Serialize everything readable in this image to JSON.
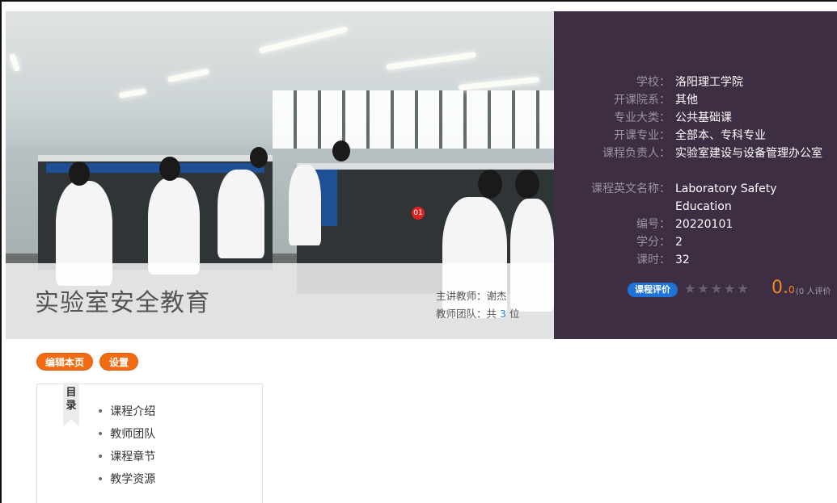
{
  "course": {
    "title": "实验室安全教育",
    "teacher_label": "主讲教师：",
    "teacher_name": "谢杰",
    "team_prefix": "教师团队：共",
    "team_count": "3",
    "team_suffix": "位"
  },
  "info": {
    "school_label": "学校：",
    "school": "洛阳理工学院",
    "dept_label": "开课院系：",
    "dept": "其他",
    "category_label": "专业大类：",
    "category": "公共基础课",
    "major_label": "开课专业：",
    "major": "全部本、专科专业",
    "owner_label": "课程负责人：",
    "owner": "实验室建设与设备管理办公室",
    "english_label": "课程英文名称：",
    "english": "Laboratory Safety Education",
    "code_label": "编号：",
    "code": "20220101",
    "credit_label": "学分：",
    "credit": "2",
    "hours_label": "课时：",
    "hours": "32"
  },
  "rating": {
    "button": "课程评价",
    "stars": "★★★★★",
    "score_int": "0.",
    "score_dec": "0",
    "count": "(0 人评价"
  },
  "actions": {
    "edit": "编辑本页",
    "settings": "设置"
  },
  "toc": {
    "ribbon_top": "目",
    "ribbon_bottom": "录",
    "items": [
      "课程介绍",
      "教师团队",
      "课程章节",
      "教学资源"
    ]
  },
  "photo": {
    "sign": "01"
  }
}
